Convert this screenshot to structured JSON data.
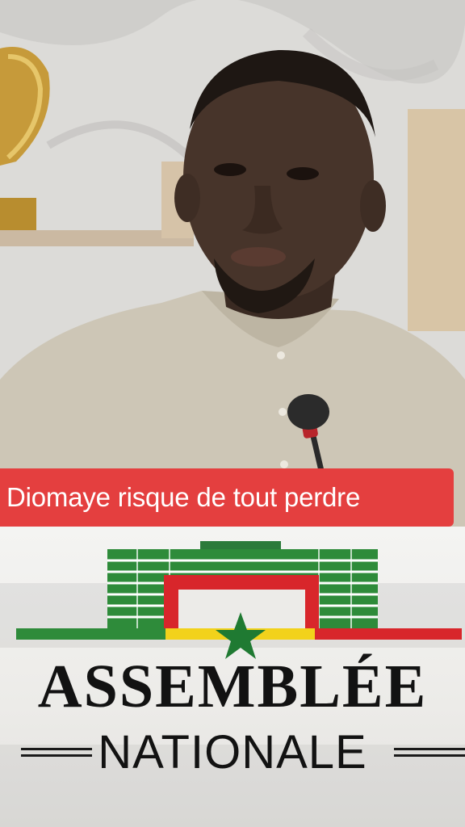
{
  "caption": {
    "text": "Diomaye risque de tout perdre",
    "background_color": "#e43f3f",
    "text_color": "#ffffff"
  },
  "logo": {
    "title_line1": "ASSEMBLÉE",
    "title_line2": "NATIONALE",
    "flag_colors": [
      "#2e8b3a",
      "#f2d21b",
      "#d8262b"
    ],
    "star_color": "#1f7a32"
  }
}
